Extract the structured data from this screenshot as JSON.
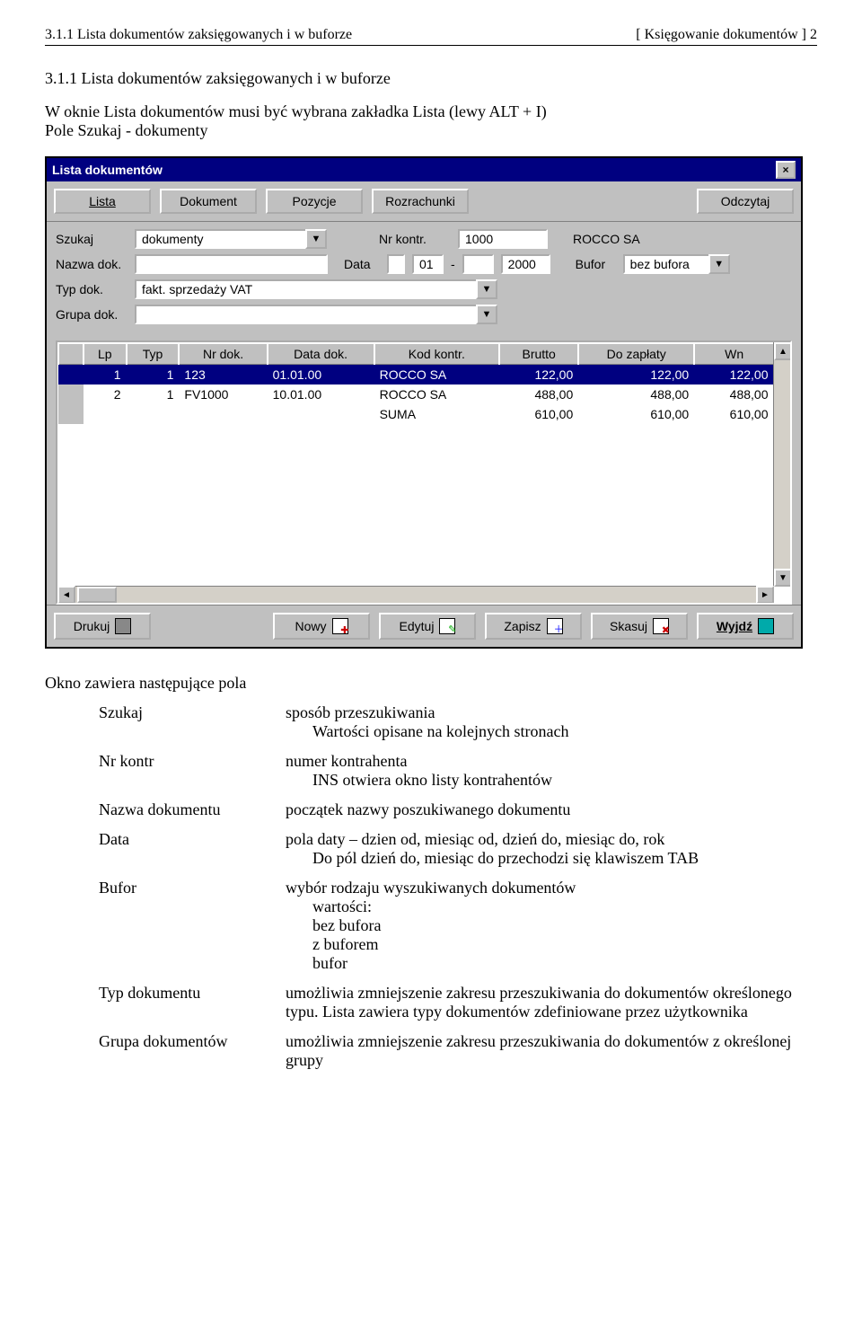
{
  "header": {
    "left": "3.1.1 Lista dokumentów zaksięgowanych i w buforze",
    "right": "[ Księgowanie dokumentów ]    2"
  },
  "section_title": "3.1.1 Lista dokumentów zaksięgowanych i w buforze",
  "intro": "W oknie Lista dokumentów musi być wybrana zakładka Lista (lewy ALT + I)\nPole Szukaj - dokumenty",
  "window": {
    "title": "Lista dokumentów",
    "close": "×",
    "tabs": [
      "Lista",
      "Dokument",
      "Pozycje",
      "Rozrachunki"
    ],
    "read_btn": "Odczytaj",
    "labels": {
      "szukaj": "Szukaj",
      "nr_kontr": "Nr kontr.",
      "nazwa_dok": "Nazwa dok.",
      "data": "Data",
      "typ_dok": "Typ dok.",
      "grupa_dok": "Grupa dok.",
      "bufor": "Bufor"
    },
    "values": {
      "szukaj": "dokumenty",
      "nr_kontr": "1000",
      "kontrahent": "ROCCO SA",
      "nazwa_dok": "",
      "data_day": "01",
      "data_month": "",
      "data_year": "2000",
      "typ_dok": "fakt. sprzedaży VAT",
      "grupa_dok": "",
      "bufor": "bez bufora"
    },
    "table": {
      "headers": [
        "",
        "Lp",
        "Typ",
        "Nr dok.",
        "Data dok.",
        "Kod kontr.",
        "Brutto",
        "Do zapłaty",
        "Wn"
      ],
      "rows": [
        {
          "sel": true,
          "lp": "1",
          "typ": "1",
          "nr": "123",
          "data": "01.01.00",
          "kod": "ROCCO SA",
          "brutto": "122,00",
          "doz": "122,00",
          "wn": "122,00"
        },
        {
          "sel": false,
          "lp": "2",
          "typ": "1",
          "nr": "FV1000",
          "data": "10.01.00",
          "kod": "ROCCO SA",
          "brutto": "488,00",
          "doz": "488,00",
          "wn": "488,00"
        }
      ],
      "sum_row": {
        "label": "SUMA",
        "brutto": "610,00",
        "doz": "610,00",
        "wn": "610,00"
      }
    },
    "bottom": {
      "print": "Drukuj",
      "new": "Nowy",
      "edit": "Edytuj",
      "save": "Zapisz",
      "del": "Skasuj",
      "exit": "Wyjdź"
    }
  },
  "defs_intro": "Okno zawiera następujące pola",
  "defs": [
    {
      "term": "Szukaj",
      "desc": "sposób przeszukiwania",
      "sub": "Wartości opisane na kolejnych stronach"
    },
    {
      "term": "Nr kontr",
      "desc": "numer kontrahenta",
      "sub": "INS otwiera okno listy kontrahentów"
    },
    {
      "term": "Nazwa dokumentu",
      "desc": "początek nazwy poszukiwanego dokumentu",
      "sub": ""
    },
    {
      "term": "Data",
      "desc": "pola daty – dzien od, miesiąc od, dzień do, miesiąc do, rok",
      "sub": "Do pól dzień do, miesiąc do przechodzi się klawiszem TAB"
    },
    {
      "term": "Bufor",
      "desc": "wybór rodzaju wyszukiwanych dokumentów",
      "sub": "wartości:\n   bez bufora\n   z buforem\n   bufor"
    },
    {
      "term": "Typ dokumentu",
      "desc": "umożliwia zmniejszenie zakresu przeszukiwania do dokumentów określonego typu. Lista zawiera typy dokumentów zdefiniowane przez użytkownika",
      "sub": ""
    },
    {
      "term": "Grupa dokumentów",
      "desc": "umożliwia zmniejszenie zakresu przeszukiwania do dokumentów z określonej grupy",
      "sub": ""
    }
  ]
}
